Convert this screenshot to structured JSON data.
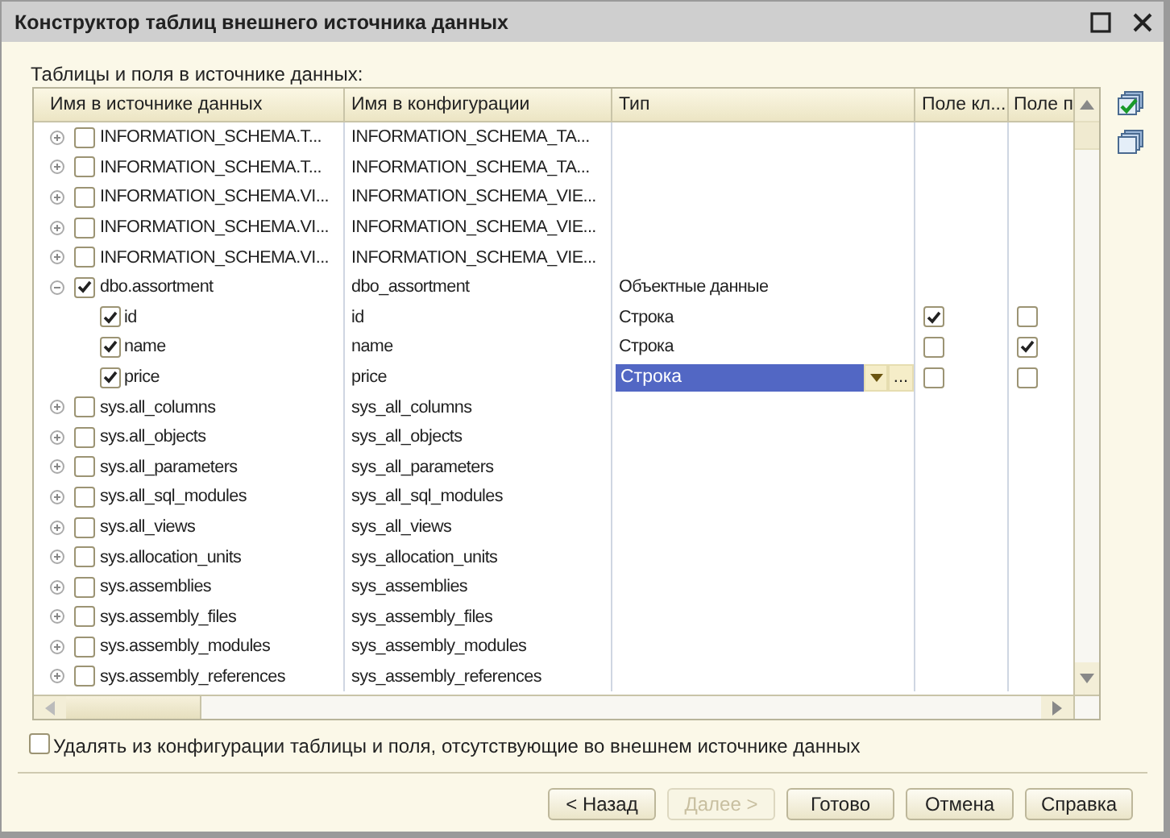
{
  "window": {
    "title": "Конструктор таблиц внешнего источника данных"
  },
  "table_label": "Таблицы и поля в источнике данных:",
  "columns": [
    "Имя в источнике данных",
    "Имя в конфигурации",
    "Тип",
    "Поле кл...",
    "Поле п"
  ],
  "rows": [
    {
      "name": "INFORMATION_SCHEMA.T...",
      "config_name": "INFORMATION_SCHEMA_TA...",
      "checked": false,
      "expanded": false
    },
    {
      "name": "INFORMATION_SCHEMA.T...",
      "config_name": "INFORMATION_SCHEMA_TA...",
      "checked": false,
      "expanded": false
    },
    {
      "name": "INFORMATION_SCHEMA.VI...",
      "config_name": "INFORMATION_SCHEMA_VIE...",
      "checked": false,
      "expanded": false
    },
    {
      "name": "INFORMATION_SCHEMA.VI...",
      "config_name": "INFORMATION_SCHEMA_VIE...",
      "checked": false,
      "expanded": false
    },
    {
      "name": "INFORMATION_SCHEMA.VI...",
      "config_name": "INFORMATION_SCHEMA_VIE...",
      "checked": false,
      "expanded": false
    },
    {
      "name": "dbo.assortment",
      "config_name": "dbo_assortment",
      "type": "Объектные данные",
      "checked": true,
      "expanded": true,
      "children": [
        {
          "name": "id",
          "config_name": "id",
          "type": "Строка",
          "checked": true,
          "key_field": true,
          "field_p": false,
          "selected": false
        },
        {
          "name": "name",
          "config_name": "name",
          "type": "Строка",
          "checked": true,
          "key_field": false,
          "field_p": true,
          "selected": false
        },
        {
          "name": "price",
          "config_name": "price",
          "type": "Строка",
          "checked": true,
          "key_field": false,
          "field_p": false,
          "selected": true,
          "more_label": "..."
        }
      ]
    },
    {
      "name": "sys.all_columns",
      "config_name": "sys_all_columns",
      "checked": false,
      "expanded": false
    },
    {
      "name": "sys.all_objects",
      "config_name": "sys_all_objects",
      "checked": false,
      "expanded": false
    },
    {
      "name": "sys.all_parameters",
      "config_name": "sys_all_parameters",
      "checked": false,
      "expanded": false
    },
    {
      "name": "sys.all_sql_modules",
      "config_name": "sys_all_sql_modules",
      "checked": false,
      "expanded": false
    },
    {
      "name": "sys.all_views",
      "config_name": "sys_all_views",
      "checked": false,
      "expanded": false
    },
    {
      "name": "sys.allocation_units",
      "config_name": "sys_allocation_units",
      "checked": false,
      "expanded": false
    },
    {
      "name": "sys.assemblies",
      "config_name": "sys_assemblies",
      "checked": false,
      "expanded": false
    },
    {
      "name": "sys.assembly_files",
      "config_name": "sys_assembly_files",
      "checked": false,
      "expanded": false
    },
    {
      "name": "sys.assembly_modules",
      "config_name": "sys_assembly_modules",
      "checked": false,
      "expanded": false
    },
    {
      "name": "sys.assembly_references",
      "config_name": "sys_assembly_references",
      "checked": false,
      "expanded": false
    }
  ],
  "delete_option": {
    "label": "Удалять из конфигурации таблицы и поля, отсутствующие во внешнем источнике данных",
    "checked": false
  },
  "buttons": [
    {
      "label": "< Назад",
      "disabled": false
    },
    {
      "label": "Далее >",
      "disabled": true
    },
    {
      "label": "Готово",
      "disabled": false
    },
    {
      "label": "Отмена",
      "disabled": false
    },
    {
      "label": "Справка",
      "disabled": false
    }
  ]
}
